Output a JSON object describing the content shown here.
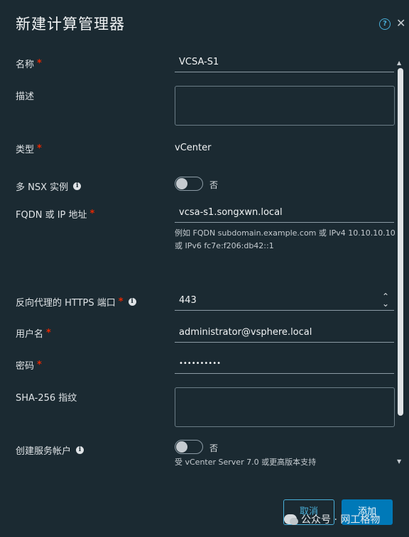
{
  "dialog": {
    "title": "新建计算管理器",
    "help_icon": "question-circle-icon",
    "close_icon": "close-icon"
  },
  "fields": {
    "name": {
      "label": "名称",
      "required": "*",
      "value": "VCSA-S1"
    },
    "description": {
      "label": "描述"
    },
    "type": {
      "label": "类型",
      "required": "*",
      "value": "vCenter"
    },
    "multi_nsx": {
      "label": "多 NSX 实例",
      "toggle_text": "否"
    },
    "fqdn": {
      "label": "FQDN 或 IP 地址",
      "required": "*",
      "value": "vcsa-s1.songxwn.local",
      "helper": "例如 FQDN subdomain.example.com 或 IPv4 10.10.10.10 或 IPv6 fc7e:f206:db42::1"
    },
    "https_port": {
      "label": "反向代理的 HTTPS 端口",
      "required": "*",
      "value": "443"
    },
    "username": {
      "label": "用户名",
      "required": "*",
      "value": "administrator@vsphere.local"
    },
    "password": {
      "label": "密码",
      "required": "*",
      "value": "••••••••••"
    },
    "sha256": {
      "label": "SHA-256 指纹"
    },
    "service_account": {
      "label": "创建服务帐户",
      "toggle_text": "否",
      "helper": "受 vCenter Server 7.0 或更高版本支持"
    }
  },
  "buttons": {
    "cancel": "取消",
    "add": "添加"
  },
  "watermark": {
    "text": "公众号 · 网工格物"
  },
  "colors": {
    "background": "#1b2a32",
    "primary": "#0079b8",
    "link": "#49afd9",
    "required": "#e62700"
  }
}
